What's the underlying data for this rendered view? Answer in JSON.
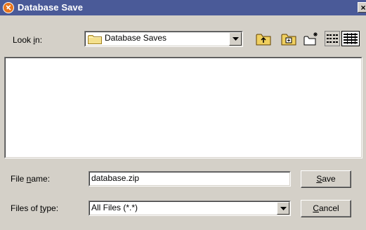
{
  "window": {
    "title": "Database Save",
    "close_glyph": "×"
  },
  "look_in": {
    "label_pre": "Look ",
    "label_mn": "i",
    "label_post": "n:",
    "value": "Database Saves",
    "folder_icon": "folder-icon"
  },
  "toolbar": {
    "up_folder_icon": "up-one-level-icon",
    "home_icon": "home-folder-icon",
    "new_folder_icon": "create-new-folder-icon",
    "list_view_icon": "list-view-icon",
    "details_view_icon": "details-view-icon"
  },
  "file_list": {
    "items": []
  },
  "file_name": {
    "label_pre": "File ",
    "label_mn": "n",
    "label_post": "ame:",
    "value": "database.zip"
  },
  "file_type": {
    "label_pre": "Files of ",
    "label_mn": "t",
    "label_post": "ype:",
    "value": "All Files (*.*)"
  },
  "buttons": {
    "save_mn": "S",
    "save_rest": "ave",
    "cancel_mn": "C",
    "cancel_rest": "ancel"
  },
  "colors": {
    "titlebar": "#4a5a98",
    "face": "#d4d0c8"
  }
}
